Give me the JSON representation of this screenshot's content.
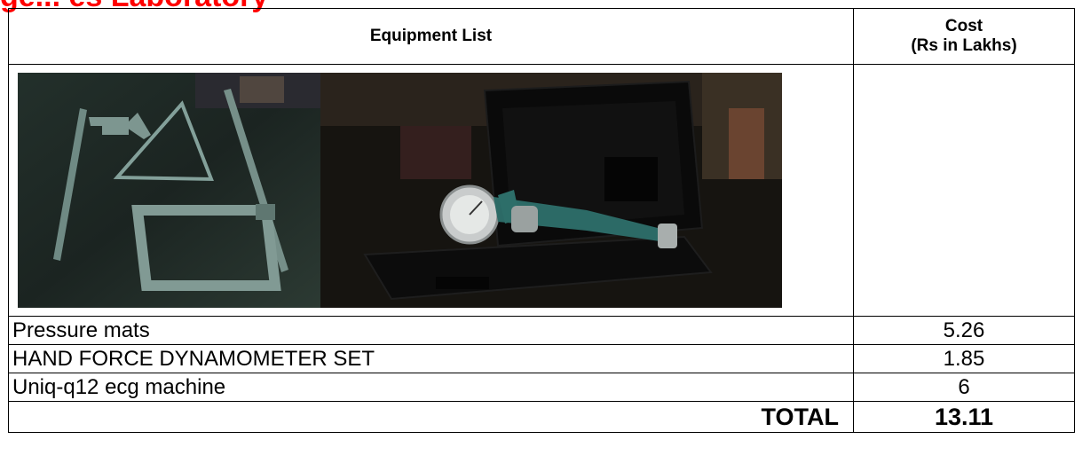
{
  "title": "ge... es Laboratory",
  "table": {
    "header": {
      "equipment": "Equipment List",
      "cost_line1": "Cost",
      "cost_line2": "(Rs in Lakhs)"
    },
    "images": [
      {
        "name": "anthropometer-calipers-photo"
      },
      {
        "name": "hand-dynamometer-case-photo"
      }
    ],
    "rows": [
      {
        "item": "Pressure mats",
        "cost": "5.26"
      },
      {
        "item": "HAND FORCE DYNAMOMETER SET",
        "cost": "1.85"
      },
      {
        "item": "Uniq-q12 ecg machine",
        "cost": "6"
      }
    ],
    "total": {
      "label": "TOTAL",
      "value": "13.11"
    }
  }
}
